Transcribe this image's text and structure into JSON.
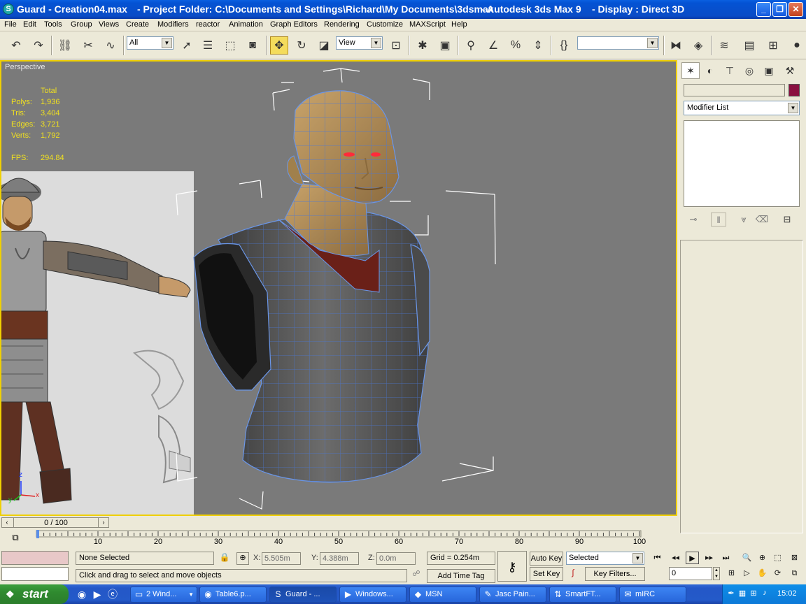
{
  "window": {
    "title_file": "Guard - Creation04.max",
    "title_project": "- Project Folder: C:\\Documents and Settings\\Richard\\My Documents\\3dsmax",
    "title_app": "- Autodesk 3ds Max 9",
    "title_display": "- Display : Direct 3D",
    "minimize": "_",
    "maximize": "❐",
    "close": "✕"
  },
  "menu": [
    "File",
    "Edit",
    "Tools",
    "Group",
    "Views",
    "Create",
    "Modifiers",
    "reactor",
    "Animation",
    "Graph Editors",
    "Rendering",
    "Customize",
    "MAXScript",
    "Help"
  ],
  "toolbar": {
    "selection_filter": "All",
    "ref_coord": "View",
    "named_selection": ""
  },
  "viewport": {
    "label": "Perspective",
    "stats_header": "Total",
    "stats": [
      {
        "label": "Polys:",
        "value": "1,936"
      },
      {
        "label": "Tris:",
        "value": "3,404"
      },
      {
        "label": "Edges:",
        "value": "3,721"
      },
      {
        "label": "Verts:",
        "value": "1,792"
      }
    ],
    "fps_label": "FPS:",
    "fps_value": "294.84",
    "axis_x": "x",
    "axis_y": "y",
    "axis_z": "z"
  },
  "command_panel": {
    "name_field": "",
    "modifier_list": "Modifier List",
    "swatch_color": "#8a1040"
  },
  "timeline": {
    "slider_label": "0 / 100",
    "ticks": [
      "10",
      "20",
      "30",
      "40",
      "50",
      "60",
      "70",
      "80",
      "90",
      "100"
    ]
  },
  "status": {
    "selection": "None Selected",
    "prompt": "Click and drag to select and move objects",
    "x_label": "X:",
    "x_value": "5.505m",
    "y_label": "Y:",
    "y_value": "4.388m",
    "z_label": "Z:",
    "z_value": "0.0m",
    "grid": "Grid = 0.254m",
    "add_time_tag": "Add Time Tag",
    "auto_key": "Auto Key",
    "set_key": "Set Key",
    "key_mode": "Selected",
    "key_filters": "Key Filters...",
    "frame": "0"
  },
  "taskbar": {
    "start": "start",
    "tasks": [
      {
        "label": "2 Wind...",
        "icon": "folder-icon"
      },
      {
        "label": "Table6.p...",
        "icon": "firefox-icon"
      },
      {
        "label": "Guard - ...",
        "icon": "3dsmax-icon"
      },
      {
        "label": "Windows...",
        "icon": "media-player-icon"
      },
      {
        "label": "MSN",
        "icon": "msn-icon"
      },
      {
        "label": "Jasc Pain...",
        "icon": "paint-shop-icon"
      },
      {
        "label": "SmartFT...",
        "icon": "ftp-icon"
      },
      {
        "label": "mIRC",
        "icon": "mirc-icon"
      }
    ],
    "clock": "15:02"
  }
}
